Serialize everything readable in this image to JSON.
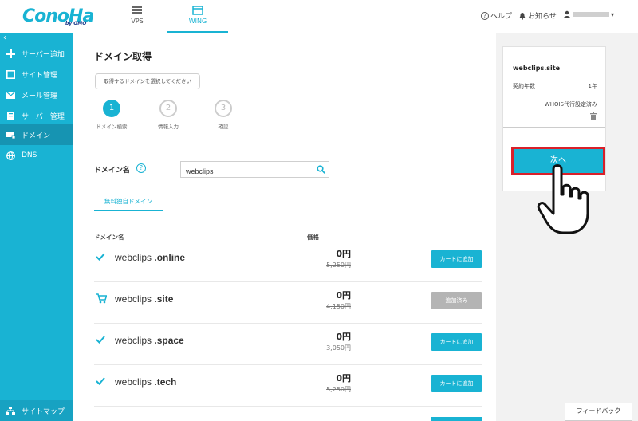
{
  "header": {
    "logo": "ConoHa",
    "logo_sub": "by GMO",
    "nav": [
      {
        "label": "VPS",
        "icon": "server-icon"
      },
      {
        "label": "WING",
        "icon": "wing-icon"
      }
    ],
    "help": "ヘルプ",
    "notice": "お知らせ"
  },
  "sidebar": {
    "items": [
      {
        "label": "サーバー追加",
        "icon": "plus-icon"
      },
      {
        "label": "サイト管理",
        "icon": "window-icon"
      },
      {
        "label": "メール管理",
        "icon": "mail-icon"
      },
      {
        "label": "サーバー管理",
        "icon": "server-icon"
      },
      {
        "label": "ドメイン",
        "icon": "domain-icon"
      },
      {
        "label": "DNS",
        "icon": "globe-icon"
      }
    ],
    "bottom": "サイトマップ"
  },
  "main": {
    "title": "ドメイン取得",
    "tooltip": "取得するドメインを選択してください",
    "steps": [
      {
        "num": "1",
        "label": "ドメイン検索"
      },
      {
        "num": "2",
        "label": "情報入力"
      },
      {
        "num": "3",
        "label": "確認"
      }
    ],
    "domain_label": "ドメイン名",
    "search_value": "webclips",
    "tab": "無料独自ドメイン",
    "col_domain": "ドメイン名",
    "col_price": "価格",
    "rows": [
      {
        "name": "webclips",
        "tld": ".online",
        "price": "0円",
        "old": "5,250円",
        "btn": "カートに追加"
      },
      {
        "name": "webclips",
        "tld": ".site",
        "price": "0円",
        "old": "4,150円",
        "btn": "追加済み"
      },
      {
        "name": "webclips",
        "tld": ".space",
        "price": "0円",
        "old": "3,050円",
        "btn": "カートに追加"
      },
      {
        "name": "webclips",
        "tld": ".tech",
        "price": "0円",
        "old": "5,250円",
        "btn": "カートに追加"
      }
    ]
  },
  "cart": {
    "domain": "webclips.site",
    "term_label": "契約年数",
    "term_value": "1年",
    "whois": "WHOIS代行設定済み",
    "next": "次へ"
  },
  "feedback": "フィードバック",
  "colors": {
    "accent": "#19b3d3",
    "highlight": "#d9202a"
  }
}
